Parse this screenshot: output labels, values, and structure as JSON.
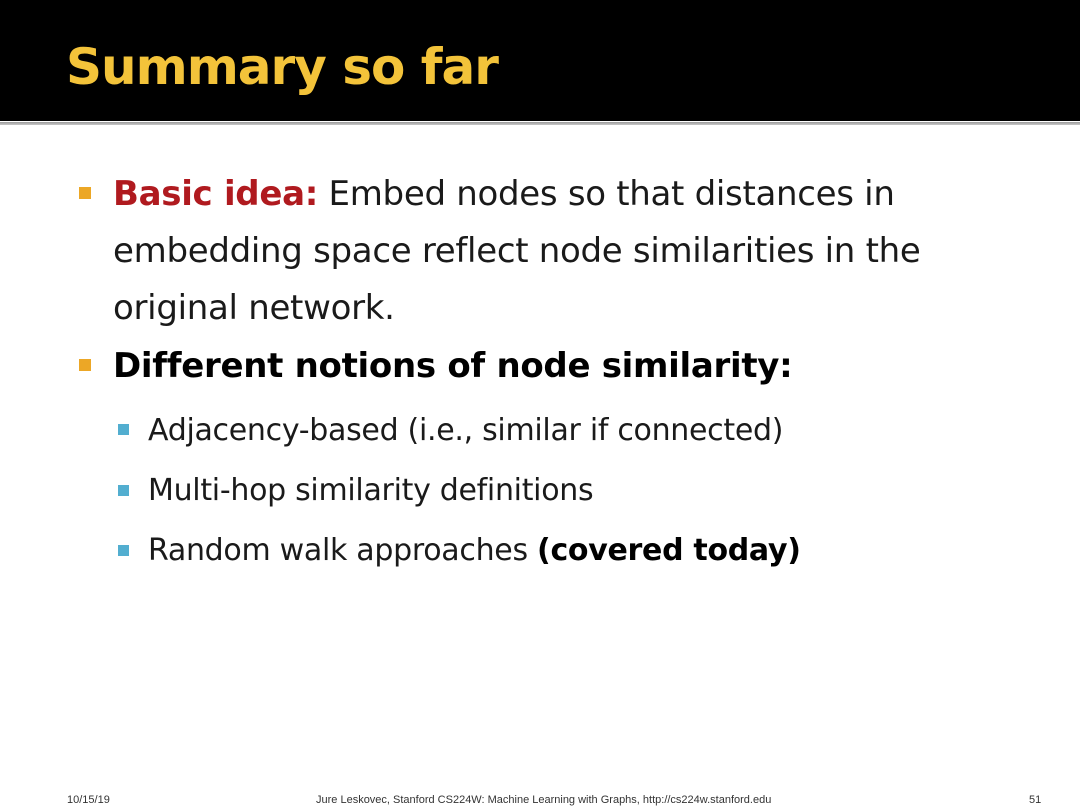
{
  "slide": {
    "title": "Summary so far",
    "bullets": [
      {
        "label": "Basic idea:",
        "text": " Embed nodes so that distances in embedding space reflect node similarities in the original network."
      },
      {
        "text": "Different notions of node similarity:",
        "sub_bullets": [
          {
            "text": "Adjacency-based (i.e., similar if connected)"
          },
          {
            "text": "Multi-hop similarity definitions"
          },
          {
            "text": "Random walk approaches ",
            "strong": "(covered today)"
          }
        ]
      }
    ],
    "colors": {
      "title": "#f3c33a",
      "title_bar": "#000000",
      "bullet_level1": "#eca726",
      "bullet_level2": "#52aed0",
      "highlight": "#b01a1f"
    }
  },
  "footer": {
    "date": "10/15/19",
    "credit": "Jure Leskovec, Stanford CS224W: Machine Learning with Graphs, http://cs224w.stanford.edu",
    "page": "51"
  }
}
